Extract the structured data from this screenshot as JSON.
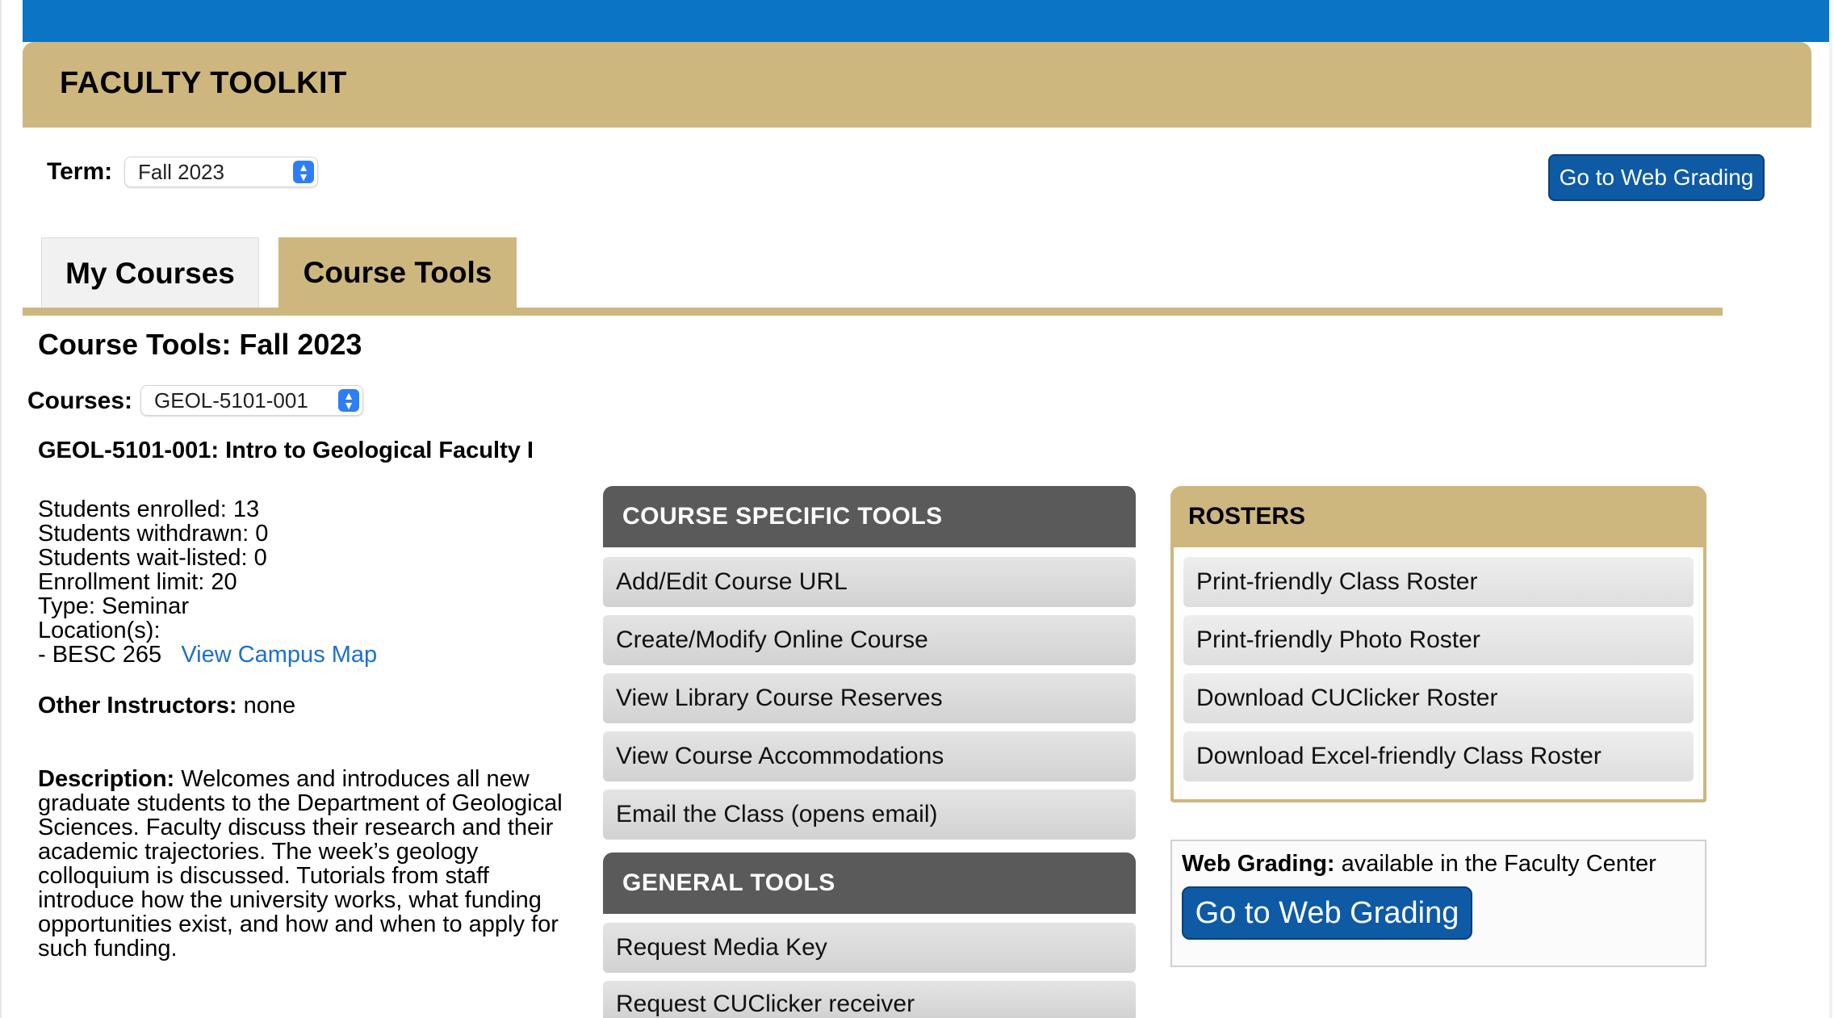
{
  "header": {
    "title": "FACULTY TOOLKIT"
  },
  "term": {
    "label": "Term:",
    "selected": "Fall 2023"
  },
  "actions": {
    "web_grading_button": "Go to Web Grading"
  },
  "tabs": [
    {
      "label": "My Courses"
    },
    {
      "label": "Course Tools"
    }
  ],
  "page": {
    "title": "Course Tools: Fall 2023"
  },
  "courses": {
    "label": "Courses:",
    "selected": "GEOL-5101-001"
  },
  "course": {
    "title": "GEOL-5101-001: Intro to Geological Faculty I",
    "stats": [
      "Students enrolled: 13",
      "Students withdrawn: 0",
      "Students wait-listed: 0",
      "Enrollment limit: 20",
      "Type: Seminar",
      "Location(s):"
    ],
    "location": "- BESC 265",
    "map_link": "View Campus Map",
    "instructors_label": "Other Instructors:",
    "instructors_value": " none",
    "description_label": "Description:",
    "description_text": " Welcomes and introduces all new graduate students to the Department of Geological Sciences. Faculty discuss their research and their academic trajectories. The week’s geology colloquium is discussed. Tutorials from staff introduce how the university works, what funding opportunities exist, and how and when to apply for such funding."
  },
  "course_specific_tools": {
    "heading": "COURSE SPECIFIC TOOLS",
    "items": [
      "Add/Edit Course URL",
      "Create/Modify Online Course",
      "View Library Course Reserves",
      "View Course Accommodations",
      "Email the Class (opens email)"
    ]
  },
  "general_tools": {
    "heading": "GENERAL TOOLS",
    "items": [
      "Request Media Key",
      "Request CUClicker receiver"
    ]
  },
  "rosters": {
    "heading": "ROSTERS",
    "items": [
      "Print-friendly Class Roster",
      "Print-friendly Photo Roster",
      "Download CUClicker Roster",
      "Download Excel-friendly Class Roster"
    ]
  },
  "web_grading": {
    "label": "Web Grading:",
    "text": " available in the Faculty Center",
    "button": "Go to Web Grading"
  },
  "colors": {
    "top_bar": "#0b74c4",
    "gold": "#cdb77e",
    "panel_dark": "#5a5a5a",
    "button_blue": "#0e5aa5",
    "link": "#1d6fce"
  }
}
